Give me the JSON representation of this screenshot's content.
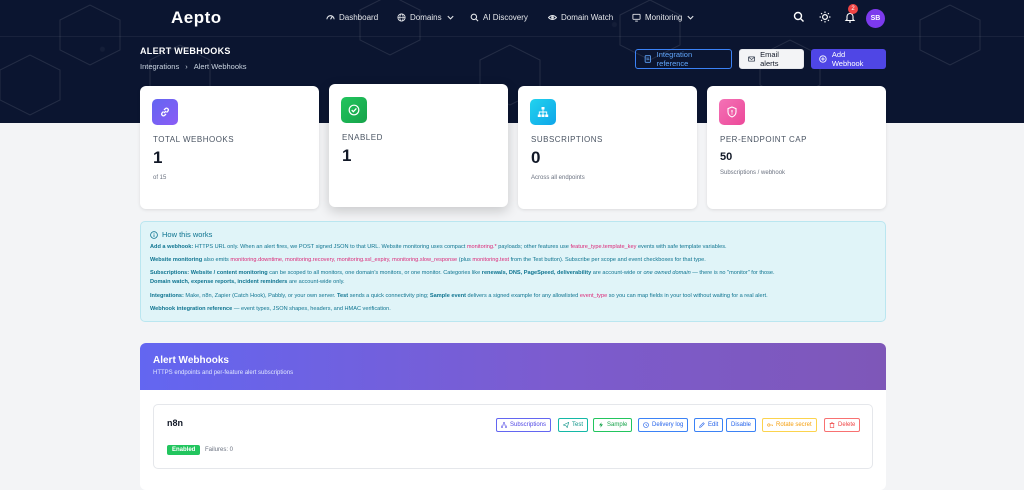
{
  "brand": {
    "name": "Aepto"
  },
  "nav": {
    "items": [
      {
        "label": "Dashboard",
        "icon": "gauge-icon"
      },
      {
        "label": "Domains",
        "icon": "globe-icon"
      },
      {
        "label": "AI Discovery",
        "icon": "search-icon"
      },
      {
        "label": "Domain Watch",
        "icon": "eye-icon"
      },
      {
        "label": "Monitoring",
        "icon": "monitor-icon"
      }
    ],
    "notification_count": "2",
    "avatar_initials": "SB"
  },
  "page": {
    "title": "ALERT WEBHOOKS",
    "breadcrumb": [
      "Integrations",
      "Alert Webhooks"
    ]
  },
  "actions": {
    "integration_reference": "Integration reference",
    "email_alerts": "Email alerts",
    "add_webhook": "Add Webhook"
  },
  "stats": [
    {
      "label": "TOTAL WEBHOOKS",
      "value": "1",
      "sub": "of 15",
      "icon": "link-icon"
    },
    {
      "label": "ENABLED",
      "value": "1",
      "sub": "",
      "icon": "check-circle-icon"
    },
    {
      "label": "SUBSCRIPTIONS",
      "value": "0",
      "sub": "Across all endpoints",
      "icon": "sitemap-icon"
    },
    {
      "label": "PER-ENDPOINT CAP",
      "value": "50",
      "sub": "Subscriptions / webhook",
      "icon": "shield-icon"
    }
  ],
  "info": {
    "title": "How this works",
    "l1": {
      "a": "Add a webhook:",
      "b": " HTTPS URL only. When an alert fires, we POST signed JSON to that URL. Website monitoring uses compact ",
      "c": "monitoring.*",
      "d": " payloads; other features use ",
      "e": "feature_type.template_key",
      "f": " events with safe template variables."
    },
    "l2": {
      "a": "Website monitoring",
      "b": " also emits ",
      "c": "monitoring.downtime, monitoring.recovery, monitoring.ssl_expiry, monitoring.slow_response",
      "d": " (plus ",
      "e": "monitoring.test",
      "f": " from the Test button). Subscribe per scope and event checkboxes for that type."
    },
    "l3": {
      "a": "Subscriptions:",
      "b": " Website / content monitoring",
      "c": " can be scoped to all monitors, one domain's monitors, or one monitor. Categories like ",
      "d": "renewals, DNS, PageSpeed, deliverability",
      "e": " are account-wide or ",
      "f": "one owned domain",
      "g": " — there is no \"monitor\" for those."
    },
    "l4": {
      "a": "Domain watch, expense reports, incident reminders",
      "b": " are account-wide only."
    },
    "l5": {
      "a": "Integrations:",
      "b": " Make, n8n, Zapier (Catch Hook), Pabbly, or your own server. ",
      "c": "Test",
      "d": " sends a quick connectivity ping; ",
      "e": "Sample event",
      "f": " delivers a signed example for any allowlisted ",
      "g": "event_type",
      "h": " so you can map fields in your tool without waiting for a real alert."
    },
    "l6": {
      "a": "Webhook integration reference",
      "b": " — event types, JSON shapes, headers, and HMAC verification."
    }
  },
  "panel": {
    "title": "Alert Webhooks",
    "subtitle": "HTTPS endpoints and per-feature alert subscriptions"
  },
  "webhook": {
    "name": "n8n",
    "status": "Enabled",
    "failures": "Failures: 0",
    "buttons": {
      "subscriptions": "Subscriptions",
      "test": "Test",
      "sample": "Sample",
      "delivery_log": "Delivery log",
      "edit": "Edit",
      "disable": "Disable",
      "rotate_secret": "Rotate secret",
      "delete": "Delete"
    }
  },
  "colors": {
    "header_bg": "#0b1530",
    "accent": "#4f46e5",
    "enabled": "#22c55e",
    "info_bg": "#e0f4f8",
    "info_text": "#0e7490",
    "code_text": "#db2777"
  }
}
